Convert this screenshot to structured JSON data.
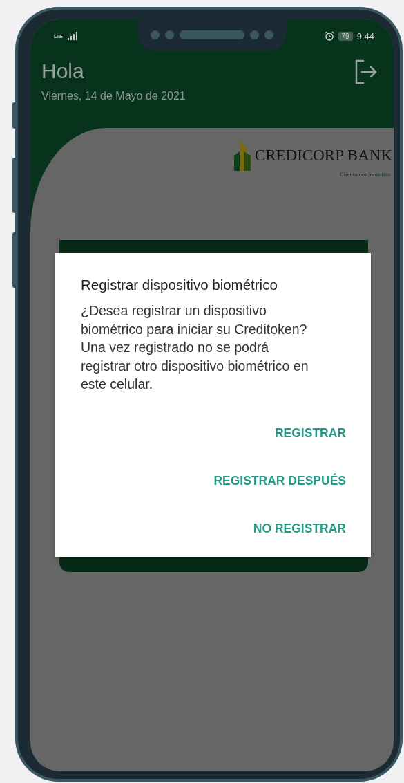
{
  "status_bar": {
    "network": "LTE",
    "battery": "79",
    "time": "9:44"
  },
  "header": {
    "greeting": "Hola",
    "date": "Viernes, 14 de Mayo de 2021"
  },
  "logo": {
    "name": "CREDICORP BANK",
    "tagline": "Cuenta con",
    "tagline_accent": "nosotros"
  },
  "dialog": {
    "title": "Registrar dispositivo biométrico",
    "message": "¿Desea registrar un dispositivo biométrico para iniciar su Creditoken? Una vez registrado no se podrá registrar otro dispositivo biométrico en este celular.",
    "actions": [
      "REGISTRAR",
      "REGISTRAR DESPUÉS",
      "NO REGISTRAR"
    ]
  }
}
